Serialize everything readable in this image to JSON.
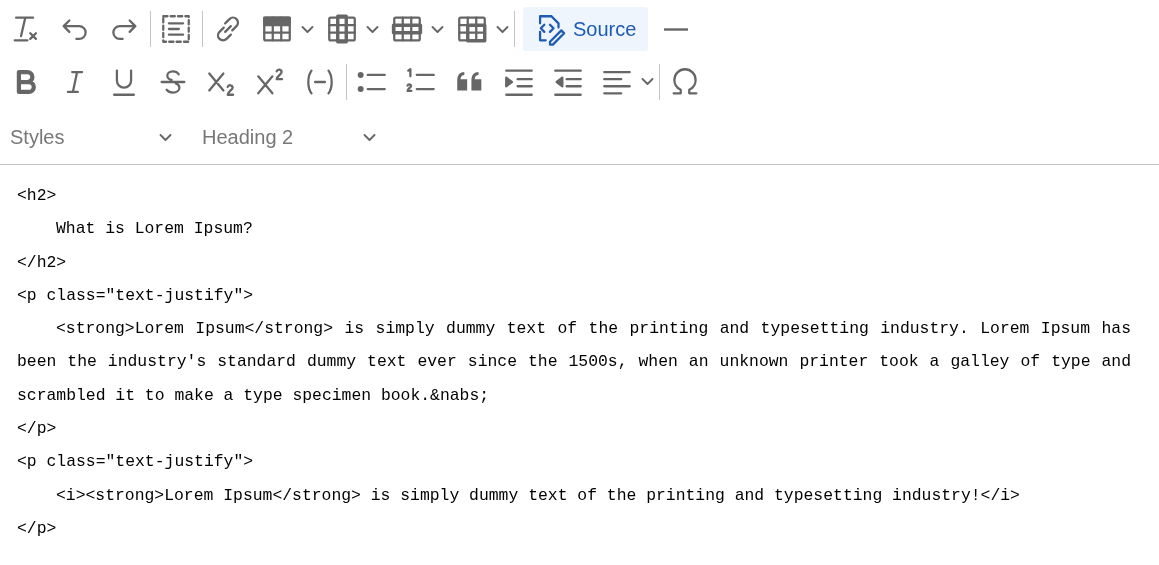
{
  "toolbar": {
    "rows": [
      [
        {
          "kind": "button"
        },
        {
          "kind": "button"
        },
        {
          "kind": "button"
        },
        {
          "kind": "separator"
        },
        {
          "kind": "button"
        },
        {
          "kind": "separator"
        },
        {
          "kind": "button"
        },
        {
          "kind": "split"
        },
        {
          "kind": "split"
        },
        {
          "kind": "split"
        },
        {
          "kind": "split"
        },
        {
          "kind": "separator"
        },
        {
          "kind": "labeled",
          "label": "Source",
          "selected": true
        },
        {
          "kind": "button"
        }
      ],
      [
        {
          "kind": "button"
        },
        {
          "kind": "button"
        },
        {
          "kind": "button"
        },
        {
          "kind": "button"
        },
        {
          "kind": "button"
        },
        {
          "kind": "button"
        },
        {
          "kind": "button"
        },
        {
          "kind": "separator"
        },
        {
          "kind": "button"
        },
        {
          "kind": "button"
        },
        {
          "kind": "button"
        },
        {
          "kind": "button"
        },
        {
          "kind": "button"
        },
        {
          "kind": "split"
        },
        {
          "kind": "separator"
        },
        {
          "kind": "button"
        }
      ]
    ],
    "dropdowns": [
      {
        "value": "Styles"
      },
      {
        "value": "Heading 2"
      }
    ]
  },
  "source": {
    "lines": [
      {
        "text": "<h2>",
        "indent": false
      },
      {
        "text": "What is Lorem Ipsum?",
        "indent": true
      },
      {
        "text": "</h2>",
        "indent": false
      },
      {
        "text": "<p class=\"text-justify\">",
        "indent": false
      },
      {
        "text": "<strong>Lorem Ipsum</strong> is simply dummy text of the printing and typesetting industry. Lorem Ipsum has been the industry's standard dummy text ever since the 1500s, when an unknown printer took a galley of type and scrambled it to make a type specimen book.&nabs;",
        "indent": true
      },
      {
        "text": "</p>",
        "indent": false
      },
      {
        "text": "<p class=\"text-justify\">",
        "indent": false
      },
      {
        "text": "<i><strong>Lorem Ipsum</strong> is simply dummy text of the printing and typesetting industry!</i>",
        "indent": true
      },
      {
        "text": "</p>",
        "indent": false
      }
    ]
  }
}
